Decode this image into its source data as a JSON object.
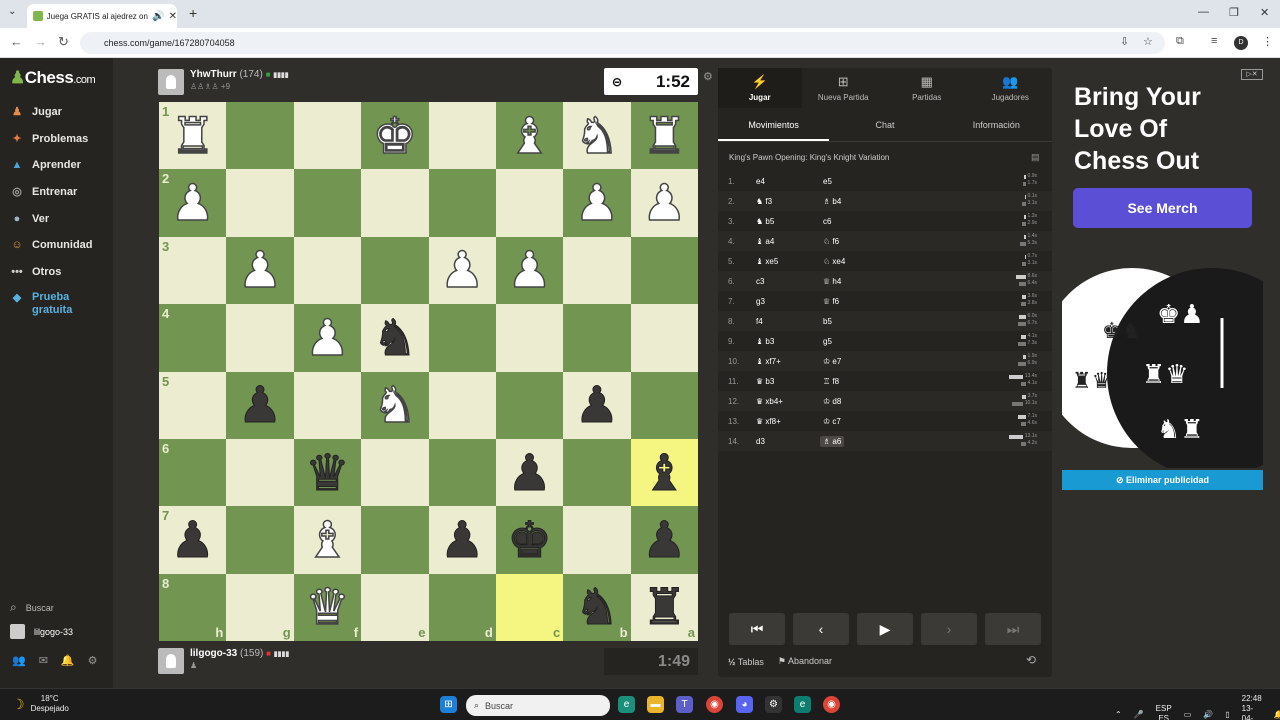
{
  "browser": {
    "tab_title": "Juega GRATIS al ajedrez online",
    "url": "chess.com/game/167280704058",
    "profile_initial": "D"
  },
  "sidebar": {
    "logo": "Chess",
    "logo_suffix": ".com",
    "items": [
      {
        "label": "Jugar",
        "icon": "pawn-play-icon",
        "color": "#e58d4b"
      },
      {
        "label": "Problemas",
        "icon": "puzzle-icon",
        "color": "#e8754a"
      },
      {
        "label": "Aprender",
        "icon": "graduation-icon",
        "color": "#4aa3df"
      },
      {
        "label": "Entrenar",
        "icon": "target-icon",
        "color": "#a0a0a0"
      },
      {
        "label": "Ver",
        "icon": "binoculars-icon",
        "color": "#9fb4c4"
      },
      {
        "label": "Comunidad",
        "icon": "community-icon",
        "color": "#e0a040"
      },
      {
        "label": "Otros",
        "icon": "more-icon",
        "color": "#ccc"
      }
    ],
    "trial_label": "Prueba gratuita",
    "search_label": "Buscar",
    "user": "lilgogo-33"
  },
  "top_player": {
    "name": "YhwThurr",
    "rating": "(174)",
    "captured": "+9"
  },
  "bottom_player": {
    "name": "lilgogo-33",
    "rating": "(159)"
  },
  "clocks": {
    "top": "1:52",
    "bottom": "1:49"
  },
  "board": {
    "ranks": [
      "1",
      "2",
      "3",
      "4",
      "5",
      "6",
      "7",
      "8"
    ],
    "files": [
      "h",
      "g",
      "f",
      "e",
      "d",
      "c",
      "b",
      "a"
    ],
    "rows": [
      [
        "wR",
        "",
        "",
        "wK",
        "",
        "wB",
        "wN",
        "wR"
      ],
      [
        "wP",
        "",
        "",
        "",
        "",
        "",
        "wP",
        "wP"
      ],
      [
        "",
        "wP",
        "",
        "",
        "wP",
        "wP",
        "",
        ""
      ],
      [
        "",
        "",
        "wP",
        "bN",
        "",
        "",
        "",
        ""
      ],
      [
        "",
        "bP",
        "",
        "wN",
        "",
        "",
        "bP",
        ""
      ],
      [
        "",
        "",
        "bQ",
        "",
        "",
        "bP",
        "",
        "bB"
      ],
      [
        "bP",
        "",
        "wB",
        "",
        "bP",
        "bK",
        "",
        "bP"
      ],
      [
        "",
        "",
        "wQ",
        "",
        "",
        "",
        "bN",
        "bR"
      ]
    ],
    "highlights": [
      "5-7",
      "7-5"
    ]
  },
  "panel": {
    "tabs": [
      {
        "label": "Jugar",
        "icon": "bolt-icon"
      },
      {
        "label": "Nueva Partida",
        "icon": "plus-icon"
      },
      {
        "label": "Partidas",
        "icon": "board-icon"
      },
      {
        "label": "Jugadores",
        "icon": "players-icon"
      }
    ],
    "subtabs": [
      "Movimientos",
      "Chat",
      "Información"
    ],
    "opening": "King's Pawn Opening: King's Knight Variation",
    "moves": [
      {
        "n": "1.",
        "w": "e4",
        "wp": "",
        "b": "e5",
        "bp": "",
        "tw": "0.9s",
        "tb": "1.7s",
        "fw": 0.08,
        "fb": 0.15
      },
      {
        "n": "2.",
        "w": "f3",
        "wp": "♞",
        "b": "b4",
        "bp": "♗",
        "tw": "0.1s",
        "tb": "3.1s",
        "fw": 0.02,
        "fb": 0.25
      },
      {
        "n": "3.",
        "w": "b5",
        "wp": "♞",
        "b": "c6",
        "bp": "",
        "tw": "1.3s",
        "tb": "2.9s",
        "fw": 0.1,
        "fb": 0.23
      },
      {
        "n": "4.",
        "w": "a4",
        "wp": "♝",
        "b": "f6",
        "bp": "♘",
        "tw": "1.4s",
        "tb": "5.3s",
        "fw": 0.11,
        "fb": 0.4
      },
      {
        "n": "5.",
        "w": "xe5",
        "wp": "♝",
        "b": "xe4",
        "bp": "♘",
        "tw": "0.7s",
        "tb": "3.1s",
        "fw": 0.06,
        "fb": 0.25
      },
      {
        "n": "6.",
        "w": "c3",
        "wp": "",
        "b": "h4",
        "bp": "♕",
        "tw": "8.6s",
        "tb": "6.4s",
        "fw": 0.65,
        "fb": 0.5
      },
      {
        "n": "7.",
        "w": "g3",
        "wp": "",
        "b": "f6",
        "bp": "♕",
        "tw": "3.6s",
        "tb": "3.8s",
        "fw": 0.28,
        "fb": 0.3
      },
      {
        "n": "8.",
        "w": "f4",
        "wp": "",
        "b": "b5",
        "bp": "",
        "tw": "6.0s",
        "tb": "6.7s",
        "fw": 0.46,
        "fb": 0.52
      },
      {
        "n": "9.",
        "w": "b3",
        "wp": "♝",
        "b": "g5",
        "bp": "",
        "tw": "4.1s",
        "tb": "7.3s",
        "fw": 0.32,
        "fb": 0.56
      },
      {
        "n": "10.",
        "w": "xf7+",
        "wp": "♝",
        "b": "e7",
        "bp": "♔",
        "tw": "1.9s",
        "tb": "6.9s",
        "fw": 0.15,
        "fb": 0.53
      },
      {
        "n": "11.",
        "w": "b3",
        "wp": "♛",
        "b": "f8",
        "bp": "♖",
        "tw": "13.4s",
        "tb": "4.1s",
        "fw": 1,
        "fb": 0.32
      },
      {
        "n": "12.",
        "w": "xb4+",
        "wp": "♛",
        "b": "d8",
        "bp": "♔",
        "tw": "3.7s",
        "tb": "10.1s",
        "fw": 0.28,
        "fb": 0.77
      },
      {
        "n": "13.",
        "w": "xf8+",
        "wp": "♛",
        "b": "c7",
        "bp": "♔",
        "tw": "7.1s",
        "tb": "4.6s",
        "fw": 0.54,
        "fb": 0.35
      },
      {
        "n": "14.",
        "w": "d3",
        "wp": "",
        "b": "a6",
        "bp": "♗",
        "tw": "13.1s",
        "tb": "4.2s",
        "fw": 0.98,
        "fb": 0.33
      }
    ],
    "draw_label": "Tablas",
    "resign_label": "Abandonar"
  },
  "ad": {
    "title": "Bring Your\nLove Of\nChess Out",
    "button": "See Merch",
    "remove": "Eliminar publicidad"
  },
  "taskbar": {
    "temp": "18°C",
    "weather": "Despejado",
    "search": "Buscar",
    "lang1": "ESP",
    "lang2": "ES",
    "time": "22:48",
    "date": "13-04-2026"
  }
}
